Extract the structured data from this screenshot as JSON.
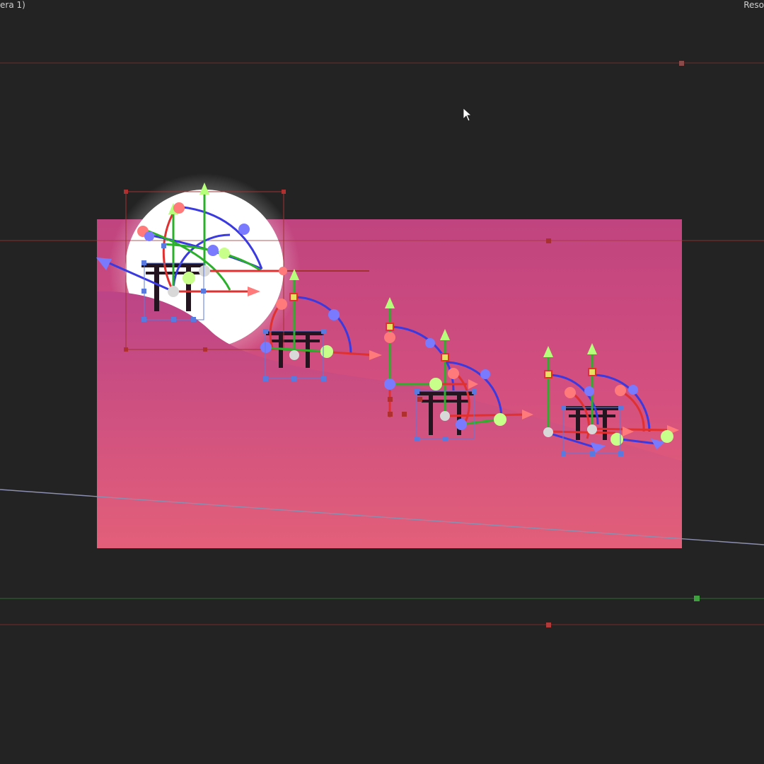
{
  "viewer": {
    "camera_label": "era 1)",
    "right_label": "Reso"
  },
  "colors": {
    "background": "#232323",
    "sky_top": "#c24585",
    "sky_bottom": "#e86478",
    "moon": "#ffffff",
    "hill": "#c64a85",
    "torii": "#2a1620",
    "axis_x": "#ff5a5a",
    "axis_y": "#a8ff6a",
    "axis_z": "#6a6aff",
    "guide_red": "#7a2c2c",
    "guide_green": "#2f6a2f",
    "guide_grey": "#8c8fb0"
  },
  "icons": {
    "cursor": "arrow-cursor-icon",
    "x_arrow": "x-axis-arrow-icon",
    "y_arrow": "y-axis-arrow-icon",
    "z_arrow": "z-axis-arrow-icon"
  }
}
